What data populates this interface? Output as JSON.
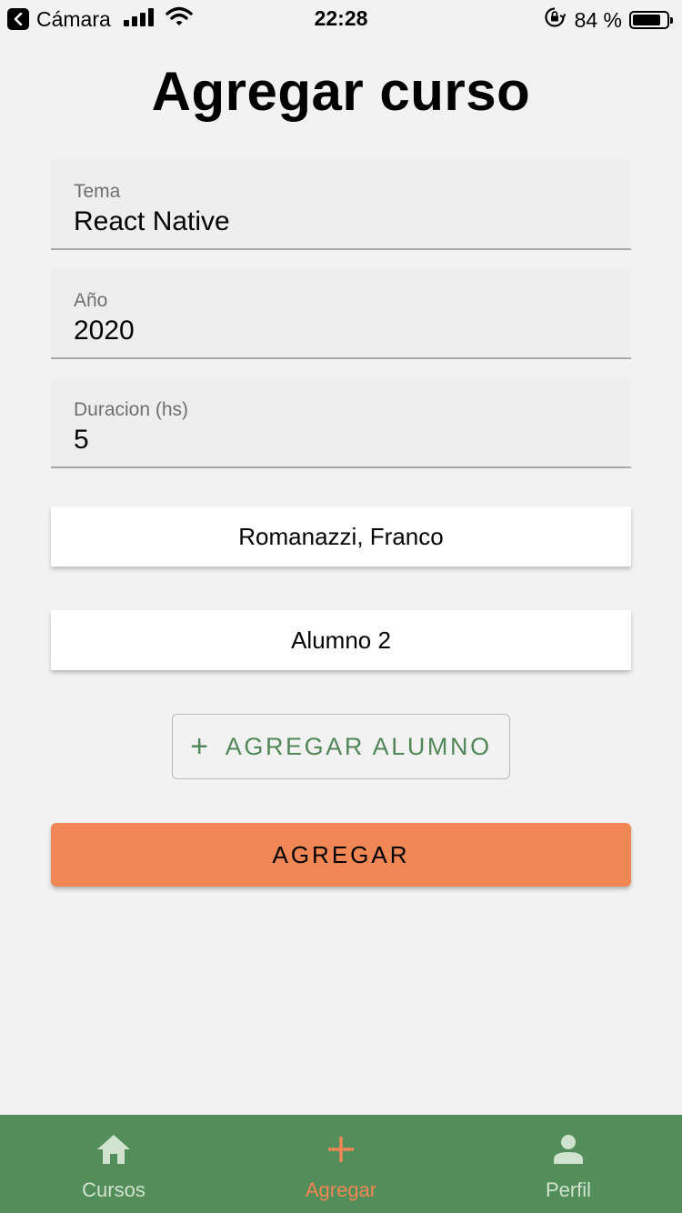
{
  "status_bar": {
    "carrier": "Cámara",
    "time": "22:28",
    "battery": "84 %"
  },
  "page": {
    "title": "Agregar curso"
  },
  "form": {
    "tema": {
      "label": "Tema",
      "value": "React Native"
    },
    "anio": {
      "label": "Año",
      "value": "2020"
    },
    "duracion": {
      "label": "Duracion (hs)",
      "value": "5"
    }
  },
  "students": [
    "Romanazzi, Franco",
    "Alumno 2"
  ],
  "buttons": {
    "add_student": "AGREGAR ALUMNO",
    "submit": "AGREGAR"
  },
  "tabs": [
    {
      "label": "Cursos",
      "icon": "home-icon",
      "active": false
    },
    {
      "label": "Agregar",
      "icon": "plus-icon",
      "active": true
    },
    {
      "label": "Perfil",
      "icon": "person-icon",
      "active": false
    }
  ],
  "colors": {
    "accent": "#f08755",
    "brand_green": "#538d59",
    "text_green": "#52875a",
    "tab_inactive": "#cfe3cf"
  }
}
